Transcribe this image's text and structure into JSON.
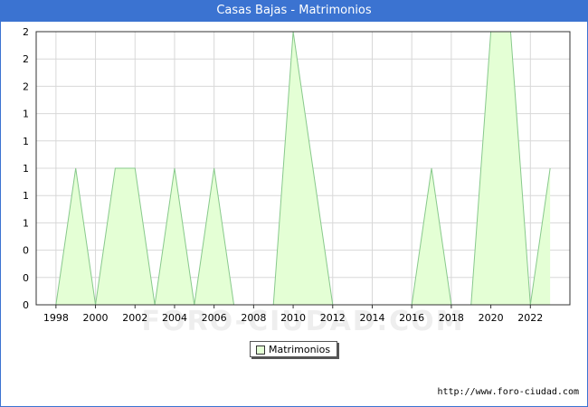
{
  "window": {
    "title": "Casas Bajas - Matrimonios",
    "source_url": "http://www.foro-ciudad.com",
    "watermark": "FORO-CIUDAD.COM"
  },
  "colors": {
    "title_bg": "#3b73d1",
    "area_fill": "#e4ffd5",
    "area_line": "#88c98c",
    "grid": "#d8d8d8"
  },
  "chart_data": {
    "type": "area",
    "title": "Casas Bajas - Matrimonios",
    "x": [
      1997,
      1998,
      1999,
      2000,
      2001,
      2002,
      2003,
      2004,
      2005,
      2006,
      2007,
      2008,
      2009,
      2010,
      2011,
      2012,
      2013,
      2014,
      2015,
      2016,
      2017,
      2018,
      2019,
      2020,
      2021,
      2022,
      2023
    ],
    "series": [
      {
        "name": "Matrimonios",
        "values": [
          0,
          0,
          1,
          0,
          1,
          1,
          0,
          1,
          0,
          1,
          0,
          0,
          0,
          2,
          1,
          0,
          0,
          0,
          0,
          0,
          1,
          0,
          0,
          2,
          2,
          0,
          1
        ]
      }
    ],
    "xticks": [
      "1998",
      "2000",
      "2002",
      "2004",
      "2006",
      "2008",
      "2010",
      "2012",
      "2014",
      "2016",
      "2018",
      "2020",
      "2022"
    ],
    "ylim": [
      0,
      2
    ],
    "yticks": [
      "0",
      "0",
      "0",
      "1",
      "1",
      "1",
      "1",
      "1",
      "2",
      "2",
      "2"
    ],
    "grid": true,
    "legend": "bottom-center"
  }
}
